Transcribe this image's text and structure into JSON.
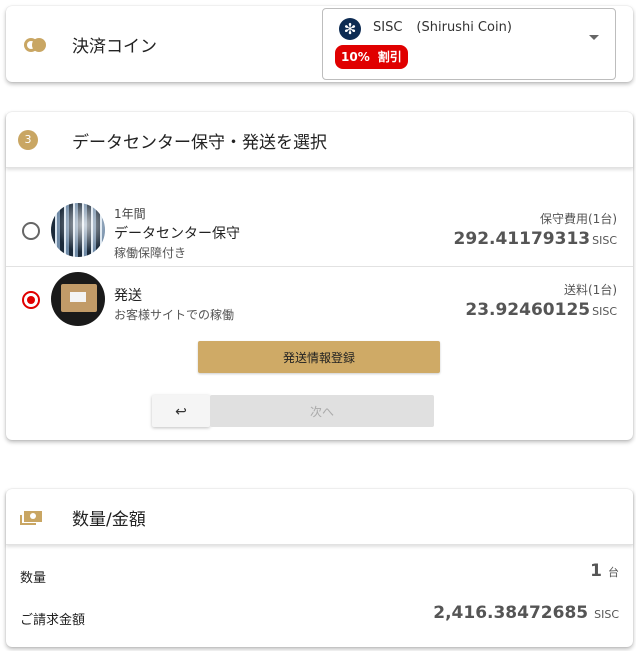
{
  "payment": {
    "title": "決済コイン",
    "coin": {
      "logo_glyph": "✻",
      "ticker": "SISC",
      "name": "(Shirushi Coin)",
      "discount_percent": "10%",
      "discount_label": "割引"
    }
  },
  "step": {
    "number": "3",
    "title": "データセンター保守・発送を選択",
    "options": [
      {
        "sub_top": "1年間",
        "title": "データセンター保守",
        "sub": "稼働保障付き",
        "price_label": "保守費用(1台)",
        "price": "292.41179313",
        "unit": "SISC",
        "selected": false
      },
      {
        "sub_top": "",
        "title": "発送",
        "sub": "お客様サイトでの稼働",
        "price_label": "送料(1台)",
        "price": "23.92460125",
        "unit": "SISC",
        "selected": true
      }
    ],
    "register_label": "発送情報登録",
    "back_label": "↩",
    "next_label": "次へ"
  },
  "summary": {
    "title": "数量/金額",
    "quantity_label": "数量",
    "quantity": "1",
    "quantity_unit": "台",
    "total_label": "ご請求金額",
    "total": "2,416.38472685",
    "total_unit": "SISC"
  },
  "colors": {
    "accent_gold": "#c9a663",
    "discount_red": "#e00000",
    "coin_navy": "#0d2b52"
  }
}
